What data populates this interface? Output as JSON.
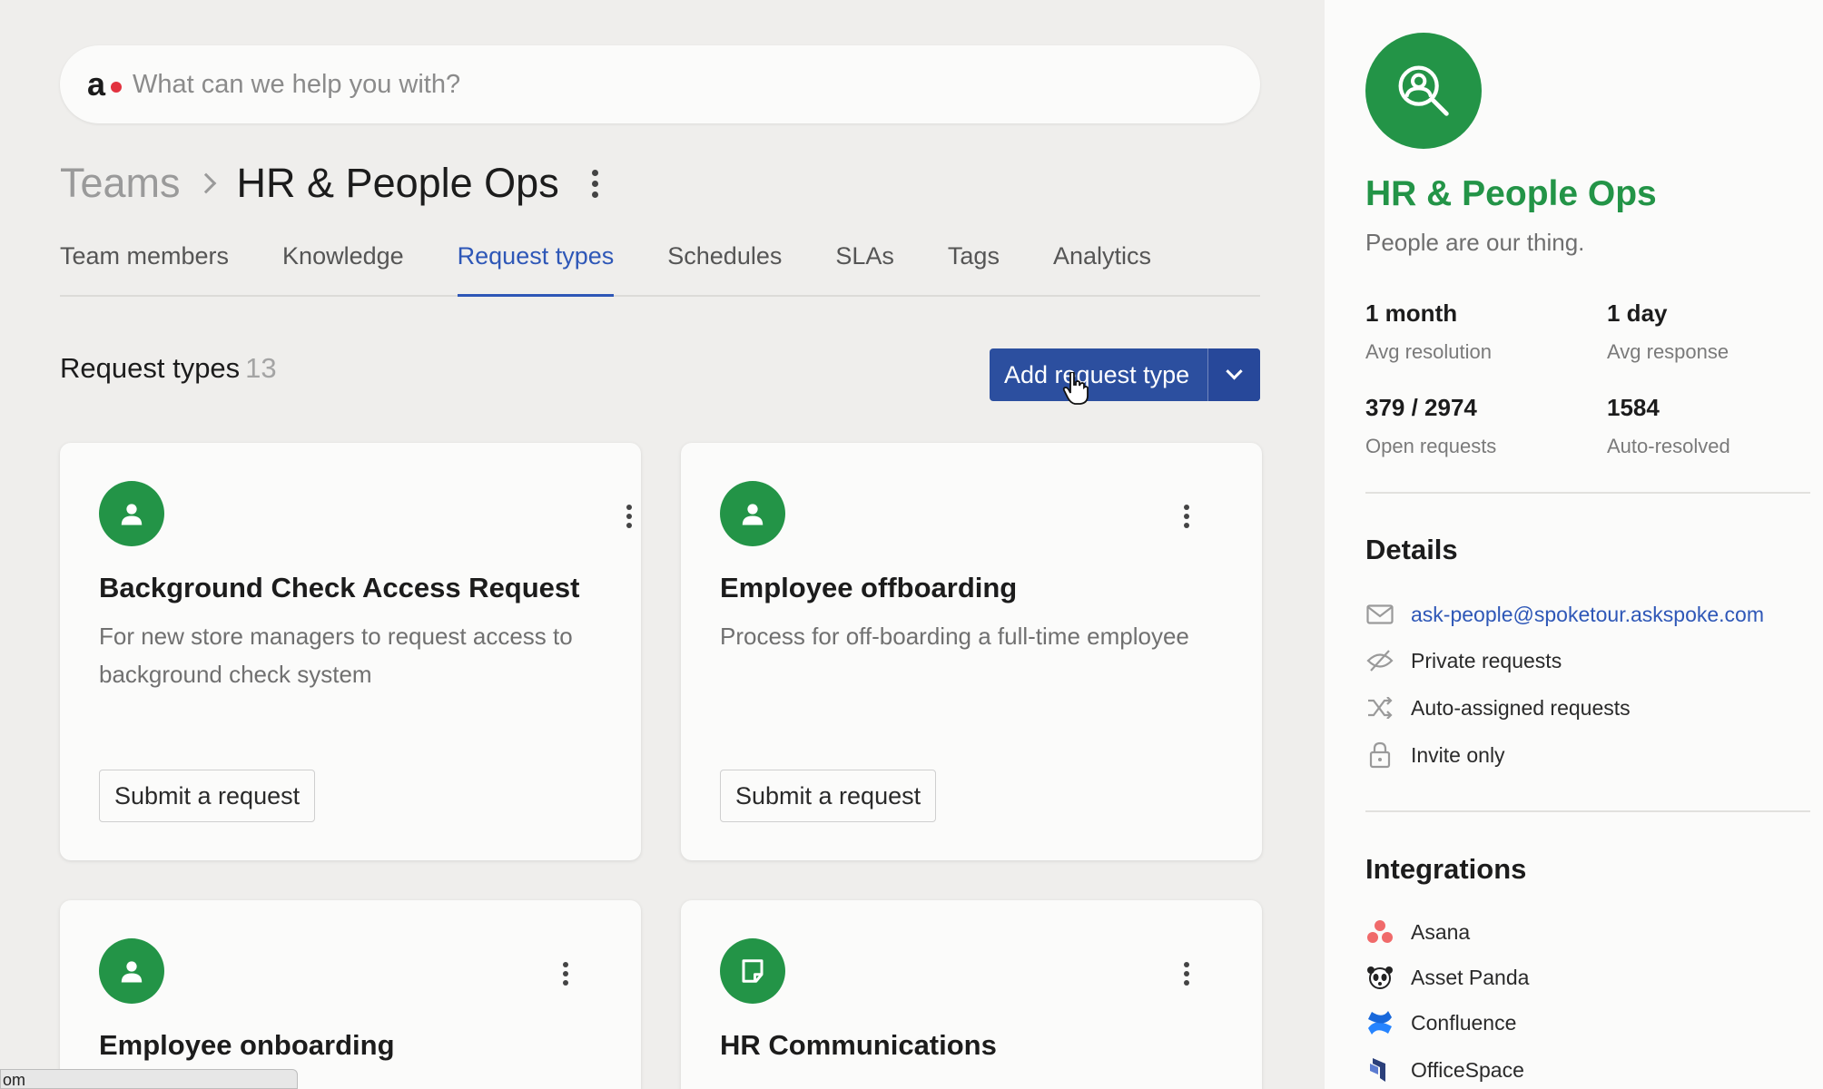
{
  "search": {
    "placeholder": "What can we help you with?",
    "logo": "a"
  },
  "breadcrumb": {
    "parent": "Teams",
    "current": "HR & People Ops"
  },
  "tabs": [
    {
      "label": "Team members"
    },
    {
      "label": "Knowledge"
    },
    {
      "label": "Request types",
      "active": true
    },
    {
      "label": "Schedules"
    },
    {
      "label": "SLAs"
    },
    {
      "label": "Tags"
    },
    {
      "label": "Analytics"
    }
  ],
  "request_types": {
    "heading": "Request types",
    "count": "13",
    "add_label": "Add request type",
    "cards": [
      {
        "title": "Background Check Access Request",
        "description": "For new store managers to request access to background check system",
        "button": "Submit a request",
        "icon": "person-icon"
      },
      {
        "title": "Employee offboarding",
        "description": "Process for off-boarding a full-time employee",
        "button": "Submit a request",
        "icon": "person-icon"
      },
      {
        "title": "Employee onboarding",
        "description": "",
        "button": "",
        "icon": "person-icon"
      },
      {
        "title": "HR Communications",
        "description": "",
        "button": "",
        "icon": "note-icon"
      }
    ]
  },
  "statusbar": {
    "text": "om"
  },
  "panel": {
    "team_name": "HR & People Ops",
    "tagline": "People are our thing.",
    "stats": [
      {
        "value": "1 month",
        "label": "Avg resolution"
      },
      {
        "value": "1 day",
        "label": "Avg response"
      },
      {
        "value": "379 / 2974",
        "label": "Open requests"
      },
      {
        "value": "1584",
        "label": "Auto-resolved"
      }
    ],
    "details_title": "Details",
    "details": [
      {
        "icon": "mail-icon",
        "text": "ask-people@spoketour.askspoke.com"
      },
      {
        "icon": "eye-off-icon",
        "text": "Private requests"
      },
      {
        "icon": "shuffle-icon",
        "text": "Auto-assigned requests"
      },
      {
        "icon": "lock-icon",
        "text": "Invite only"
      }
    ],
    "integrations_title": "Integrations",
    "integrations": [
      {
        "icon": "asana-icon",
        "text": "Asana"
      },
      {
        "icon": "asset-panda-icon",
        "text": "Asset Panda"
      },
      {
        "icon": "confluence-icon",
        "text": "Confluence"
      },
      {
        "icon": "officespace-icon",
        "text": "OfficeSpace"
      }
    ]
  },
  "colors": {
    "brand_green": "#239447",
    "accent_blue": "#2e57b7",
    "button_blue": "#2c4f9f"
  }
}
